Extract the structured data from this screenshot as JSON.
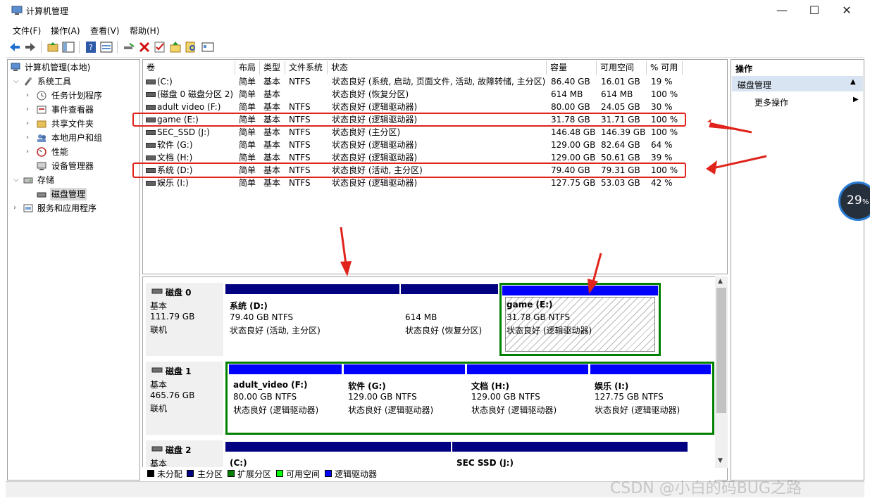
{
  "window": {
    "title": "计算机管理"
  },
  "menu": [
    "文件(F)",
    "操作(A)",
    "查看(V)",
    "帮助(H)"
  ],
  "tree": {
    "root": "计算机管理(本地)",
    "system_tools": "系统工具",
    "task_scheduler": "任务计划程序",
    "event_viewer": "事件查看器",
    "shared_folders": "共享文件夹",
    "local_users": "本地用户和组",
    "performance": "性能",
    "device_manager": "设备管理器",
    "storage": "存储",
    "disk_management": "磁盘管理",
    "services": "服务和应用程序"
  },
  "columns": [
    "卷",
    "布局",
    "类型",
    "文件系统",
    "状态",
    "容量",
    "可用空间",
    "% 可用"
  ],
  "volumes": [
    [
      "(C:)",
      "简单",
      "基本",
      "NTFS",
      "状态良好 (系统, 启动, 页面文件, 活动, 故障转储, 主分区)",
      "86.40 GB",
      "16.01 GB",
      "19 %"
    ],
    [
      "(磁盘 0 磁盘分区 2)",
      "简单",
      "基本",
      "",
      "状态良好 (恢复分区)",
      "614 MB",
      "614 MB",
      "100 %"
    ],
    [
      "adult video (F:)",
      "简单",
      "基本",
      "NTFS",
      "状态良好 (逻辑驱动器)",
      "80.00 GB",
      "24.05 GB",
      "30 %"
    ],
    [
      "game (E:)",
      "简单",
      "基本",
      "NTFS",
      "状态良好 (逻辑驱动器)",
      "31.78 GB",
      "31.71 GB",
      "100 %"
    ],
    [
      "SEC_SSD (J:)",
      "简单",
      "基本",
      "NTFS",
      "状态良好 (主分区)",
      "146.48 GB",
      "146.39 GB",
      "100 %"
    ],
    [
      "软件 (G:)",
      "简单",
      "基本",
      "NTFS",
      "状态良好 (逻辑驱动器)",
      "129.00 GB",
      "82.64 GB",
      "64 %"
    ],
    [
      "文档 (H:)",
      "简单",
      "基本",
      "NTFS",
      "状态良好 (逻辑驱动器)",
      "129.00 GB",
      "50.61 GB",
      "39 %"
    ],
    [
      "系统 (D:)",
      "简单",
      "基本",
      "NTFS",
      "状态良好 (活动, 主分区)",
      "79.40 GB",
      "79.31 GB",
      "100 %"
    ],
    [
      "娱乐 (I:)",
      "简单",
      "基本",
      "NTFS",
      "状态良好 (逻辑驱动器)",
      "127.75 GB",
      "53.03 GB",
      "42 %"
    ]
  ],
  "disks": [
    {
      "name": "磁盘 0",
      "type": "基本",
      "size": "111.79 GB",
      "state": "联机",
      "parts": [
        {
          "name": "系统  (D:)",
          "size": "79.40 GB NTFS",
          "status": "状态良好 (活动, 主分区)"
        },
        {
          "name": "",
          "size": "614 MB",
          "status": "状态良好 (恢复分区)"
        },
        {
          "name": "game  (E:)",
          "size": "31.78 GB NTFS",
          "status": "状态良好 (逻辑驱动器)"
        }
      ]
    },
    {
      "name": "磁盘 1",
      "type": "基本",
      "size": "465.76 GB",
      "state": "联机",
      "parts": [
        {
          "name": "adult_video  (F:)",
          "size": "80.00 GB NTFS",
          "status": "状态良好 (逻辑驱动器)"
        },
        {
          "name": "软件  (G:)",
          "size": "129.00 GB NTFS",
          "status": "状态良好 (逻辑驱动器)"
        },
        {
          "name": "文档  (H:)",
          "size": "129.00 GB NTFS",
          "status": "状态良好 (逻辑驱动器)"
        },
        {
          "name": "娱乐  (I:)",
          "size": "127.75 GB NTFS",
          "status": "状态良好 (逻辑驱动器)"
        }
      ]
    },
    {
      "name": "磁盘 2",
      "type": "基本",
      "size": "",
      "state": "",
      "parts": [
        {
          "name": "(C:)",
          "size": "",
          "status": ""
        },
        {
          "name": "SEC SSD  (J:)",
          "size": "",
          "status": ""
        }
      ]
    }
  ],
  "legend": [
    "未分配",
    "主分区",
    "扩展分区",
    "可用空间",
    "逻辑驱动器"
  ],
  "legend_colors": [
    "#000000",
    "#000080",
    "#008000",
    "#00ff00",
    "#0000ff"
  ],
  "actions": {
    "header": "操作",
    "section": "磁盘管理",
    "more": "更多操作"
  },
  "overlay": {
    "percent_badge": "29",
    "percent_sign": "%"
  },
  "watermark": "CSDN @小白的码BUG之路",
  "colors": {
    "primary_bar": "#000080",
    "logical_bar": "#0000ff",
    "extended_border": "#008000",
    "annotation_red": "#e0241b"
  }
}
